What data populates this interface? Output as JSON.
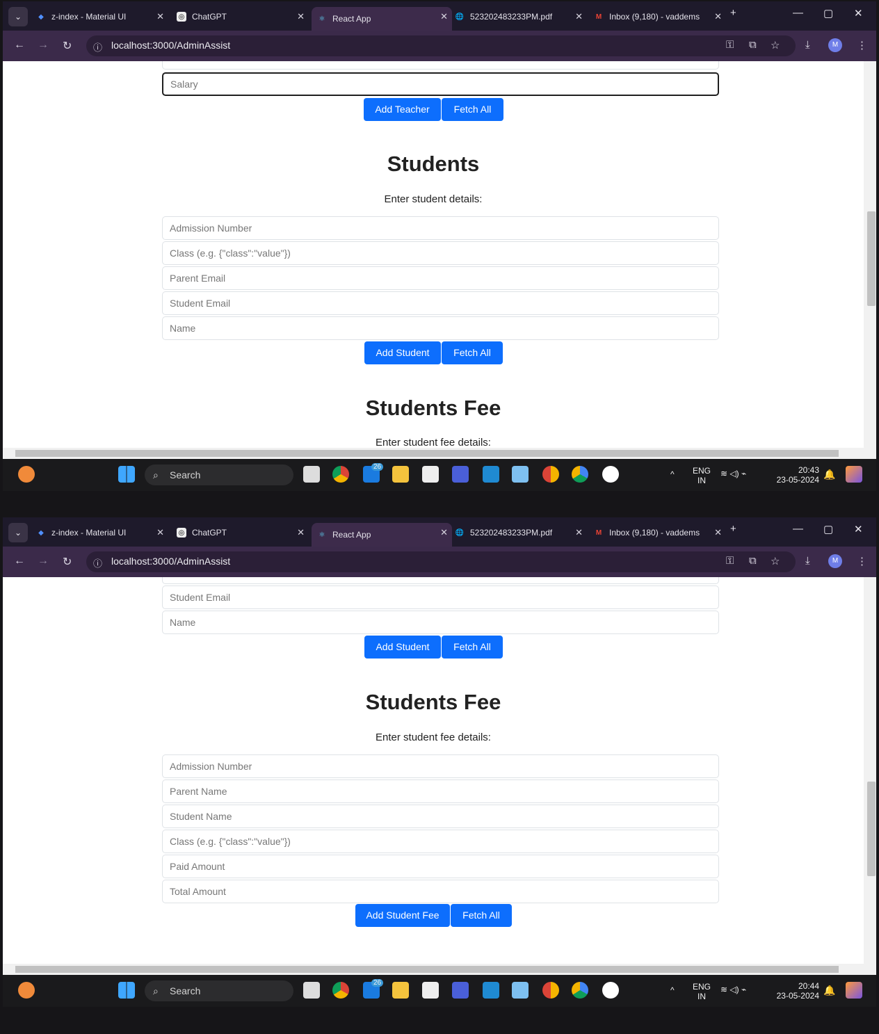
{
  "browser": {
    "tabs": [
      {
        "title": "z-index - Material UI",
        "icon": "mui-icon",
        "color": "#5090ff"
      },
      {
        "title": "ChatGPT",
        "icon": "chatgpt-icon",
        "color": "#d8d8d8"
      },
      {
        "title": "React App",
        "icon": "react-icon",
        "color": "#61dafb"
      },
      {
        "title": "523202483233PM.pdf",
        "icon": "globe-icon",
        "color": "#d8d8d8"
      },
      {
        "title": "Inbox (9,180) - vaddems",
        "icon": "gmail-icon",
        "color": "#ea4335"
      }
    ],
    "url": "localhost:3000/AdminAssist",
    "avatar": "M"
  },
  "page": {
    "teacher": {
      "salary_placeholder": "Salary",
      "add_button": "Add Teacher",
      "fetch_button": "Fetch All"
    },
    "students": {
      "title": "Students",
      "subtitle": "Enter student details:",
      "fields": [
        "Admission Number",
        "Class (e.g. {\"class\":\"value\"})",
        "Parent Email",
        "Student Email",
        "Name"
      ],
      "add_button": "Add Student",
      "fetch_button": "Fetch All"
    },
    "student_fee": {
      "title": "Students Fee",
      "subtitle": "Enter student fee details:",
      "fields": [
        "Admission Number",
        "Parent Name",
        "Student Name",
        "Class (e.g. {\"class\":\"value\"})",
        "Paid Amount",
        "Total Amount"
      ],
      "add_button": "Add Student Fee",
      "fetch_button": "Fetch All"
    }
  },
  "taskbar": {
    "search_label": "Search",
    "lang": "ENG",
    "region": "IN",
    "date": "23-05-2024",
    "time_top": "20:43",
    "time_bottom": "20:44",
    "mail_badge": "26"
  }
}
